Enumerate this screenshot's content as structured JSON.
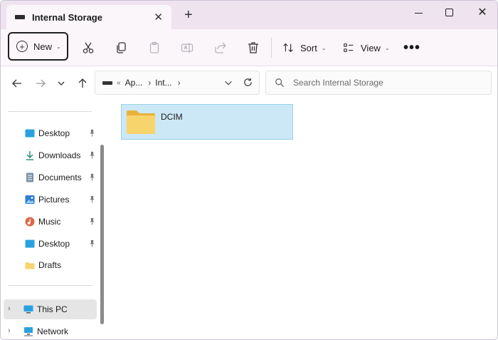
{
  "tab": {
    "title": "Internal Storage",
    "close": "✕",
    "new_tab": "+"
  },
  "window_controls": {
    "close": "✕"
  },
  "toolbar": {
    "new_label": "New",
    "sort_label": "Sort",
    "view_label": "View",
    "more": "•••"
  },
  "address": {
    "crumbs": [
      "Ap...",
      "Int..."
    ],
    "overflow": "«",
    "separator": "›"
  },
  "search": {
    "placeholder": "Search Internal Storage"
  },
  "sidebar": {
    "items": [
      {
        "label": "Desktop",
        "icon": "desktop-icon",
        "pinned": true
      },
      {
        "label": "Downloads",
        "icon": "download-icon",
        "pinned": true
      },
      {
        "label": "Documents",
        "icon": "documents-icon",
        "pinned": true
      },
      {
        "label": "Pictures",
        "icon": "pictures-icon",
        "pinned": true
      },
      {
        "label": "Music",
        "icon": "music-icon",
        "pinned": true
      },
      {
        "label": "Desktop",
        "icon": "desktop-icon",
        "pinned": true
      },
      {
        "label": "Drafts",
        "icon": "folder-icon",
        "pinned": false
      }
    ],
    "tree": [
      {
        "label": "This PC",
        "icon": "pc-icon",
        "selected": true
      },
      {
        "label": "Network",
        "icon": "network-icon",
        "selected": false
      }
    ]
  },
  "content": {
    "folders": [
      {
        "name": "DCIM",
        "selected": true
      }
    ]
  },
  "colors": {
    "titlebar": "#efe3ef",
    "toolbar": "#faf6fa",
    "selection": "#cce8f7",
    "selection_border": "#99d1ef",
    "folder": "#f8d46c"
  }
}
